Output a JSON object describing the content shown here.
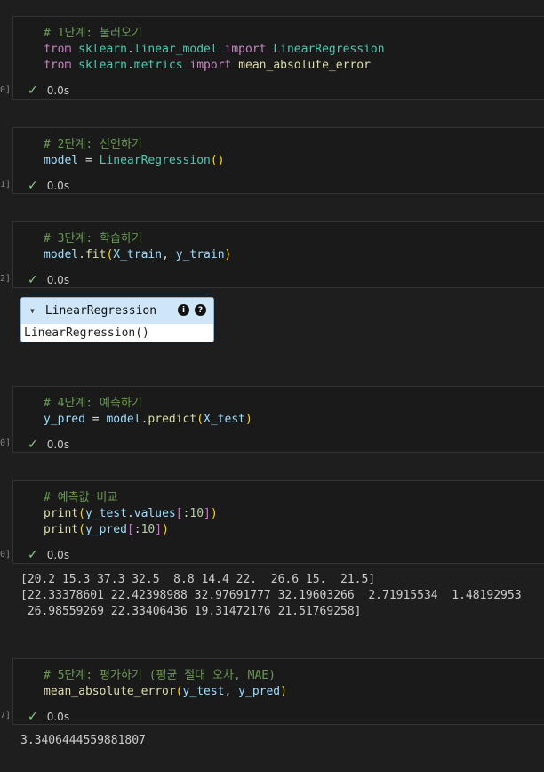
{
  "cells": [
    {
      "id": "cell1",
      "gutter": "0]",
      "lines": [
        [
          [
            "c-comment",
            "# 1단계: 불러오기"
          ]
        ],
        [
          [
            "c-kw",
            "from"
          ],
          [
            "c-op",
            " "
          ],
          [
            "c-mod",
            "sklearn"
          ],
          [
            "c-op",
            "."
          ],
          [
            "c-mod",
            "linear_model"
          ],
          [
            "c-op",
            " "
          ],
          [
            "c-kw",
            "import"
          ],
          [
            "c-op",
            " "
          ],
          [
            "c-cls",
            "LinearRegression"
          ]
        ],
        [
          [
            "c-kw",
            "from"
          ],
          [
            "c-op",
            " "
          ],
          [
            "c-mod",
            "sklearn"
          ],
          [
            "c-op",
            "."
          ],
          [
            "c-mod",
            "metrics"
          ],
          [
            "c-op",
            " "
          ],
          [
            "c-kw",
            "import"
          ],
          [
            "c-op",
            " "
          ],
          [
            "c-fn",
            "mean_absolute_error"
          ]
        ]
      ],
      "time": "0.0s"
    },
    {
      "id": "cell2",
      "gutter": "1]",
      "lines": [
        [
          [
            "c-comment",
            "# 2단계: 선언하기"
          ]
        ],
        [
          [
            "c-var",
            "model"
          ],
          [
            "c-op",
            " = "
          ],
          [
            "c-cls",
            "LinearRegression"
          ],
          [
            "c-p1",
            "()"
          ]
        ]
      ],
      "time": "0.0s"
    },
    {
      "id": "cell3",
      "gutter": "2]",
      "lines": [
        [
          [
            "c-comment",
            "# 3단계: 학습하기"
          ]
        ],
        [
          [
            "c-var",
            "model"
          ],
          [
            "c-op",
            "."
          ],
          [
            "c-fn",
            "fit"
          ],
          [
            "c-p1",
            "("
          ],
          [
            "c-var",
            "X_train"
          ],
          [
            "c-op",
            ", "
          ],
          [
            "c-var",
            "y_train"
          ],
          [
            "c-p1",
            ")"
          ]
        ]
      ],
      "time": "0.0s"
    },
    {
      "id": "cell4",
      "gutter": "0]",
      "lines": [
        [
          [
            "c-comment",
            "# 4단계: 예측하기"
          ]
        ],
        [
          [
            "c-var",
            "y_pred"
          ],
          [
            "c-op",
            " = "
          ],
          [
            "c-var",
            "model"
          ],
          [
            "c-op",
            "."
          ],
          [
            "c-fn",
            "predict"
          ],
          [
            "c-p1",
            "("
          ],
          [
            "c-var",
            "X_test"
          ],
          [
            "c-p1",
            ")"
          ]
        ]
      ],
      "time": "0.0s"
    },
    {
      "id": "cell5",
      "gutter": "0]",
      "lines": [
        [
          [
            "c-comment",
            "# 예측값 비교"
          ]
        ],
        [
          [
            "c-fn",
            "print"
          ],
          [
            "c-p1",
            "("
          ],
          [
            "c-var",
            "y_test"
          ],
          [
            "c-op",
            "."
          ],
          [
            "c-var",
            "values"
          ],
          [
            "c-p2",
            "["
          ],
          [
            "c-op",
            ":"
          ],
          [
            "c-num",
            "10"
          ],
          [
            "c-p2",
            "]"
          ],
          [
            "c-p1",
            ")"
          ]
        ],
        [
          [
            "c-fn",
            "print"
          ],
          [
            "c-p1",
            "("
          ],
          [
            "c-var",
            "y_pred"
          ],
          [
            "c-p2",
            "["
          ],
          [
            "c-op",
            ":"
          ],
          [
            "c-num",
            "10"
          ],
          [
            "c-p2",
            "]"
          ],
          [
            "c-p1",
            ")"
          ]
        ]
      ],
      "time": "0.0s"
    },
    {
      "id": "cell6",
      "gutter": "7]",
      "lines": [
        [
          [
            "c-comment",
            "# 5단계: 평가하기 (평균 절대 오차, MAE)"
          ]
        ],
        [
          [
            "c-fn",
            "mean_absolute_error"
          ],
          [
            "c-p1",
            "("
          ],
          [
            "c-var",
            "y_test"
          ],
          [
            "c-op",
            ", "
          ],
          [
            "c-var",
            "y_pred"
          ],
          [
            "c-p1",
            ")"
          ]
        ]
      ],
      "time": "0.0s"
    }
  ],
  "widget": {
    "title": "LinearRegression",
    "body": "LinearRegression()",
    "badge1": "i",
    "badge2": "?"
  },
  "outputs": {
    "print_output": "[20.2 15.3 37.3 32.5  8.8 14.4 22.  26.6 15.  21.5]\n[22.33378601 22.42398988 32.97691777 32.19603266  2.71915534  1.48192953\n 26.98559269 22.33406436 19.31472176 21.51769258]",
    "mae_output": "3.3406444559881807"
  }
}
